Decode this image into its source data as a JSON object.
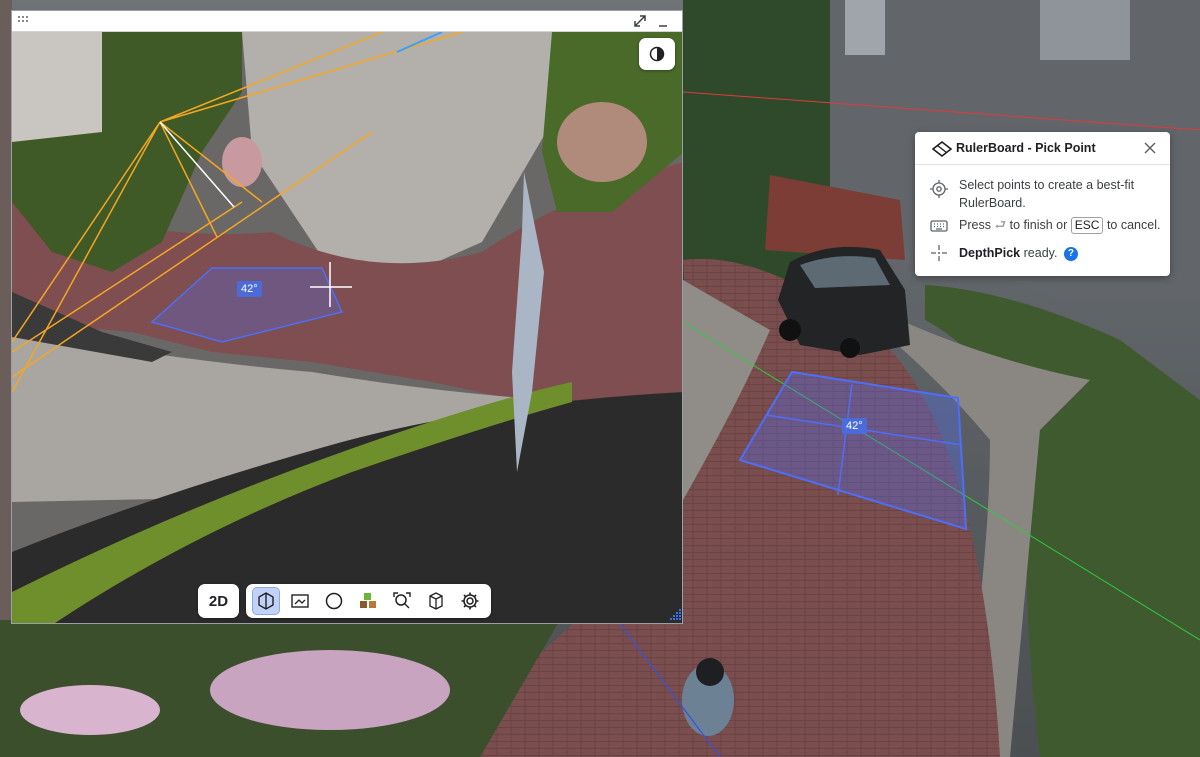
{
  "mini_view": {
    "contrast_icon": "contrast-icon",
    "expand_icon": "expand-icon",
    "minimize_icon": "minimize-icon",
    "drag_icon": "drag-grid-icon",
    "angle_label": "42°"
  },
  "main_view": {
    "angle_label": "42°"
  },
  "toolbar": {
    "mode_label": "2D",
    "tools": [
      {
        "name": "3d-box-icon",
        "active": true
      },
      {
        "name": "camera-view-icon",
        "active": false
      },
      {
        "name": "sphere-icon",
        "active": false
      },
      {
        "name": "cubes-icon",
        "active": false
      },
      {
        "name": "zoom-search-icon",
        "active": false
      },
      {
        "name": "measure-box-icon",
        "active": false
      },
      {
        "name": "settings-icon",
        "active": false
      }
    ]
  },
  "dialog": {
    "title": "RulerBoard - Pick Point",
    "line1_a": "Select points to create a best-fit",
    "line1_b": "RulerBoard.",
    "line2_press": "Press",
    "line2_enter": "⮐",
    "line2_finish": "to finish or",
    "line2_key": "ESC",
    "line2_cancel": "to cancel.",
    "line3_bold": "DepthPick",
    "line3_rest": "ready.",
    "help": "?"
  },
  "colors": {
    "accent": "#1a73e8",
    "guide_orange": "#f5a623",
    "plane_blue": "#4f6ef7",
    "axis_green": "#2ecc40",
    "axis_red": "#e03b3b"
  }
}
